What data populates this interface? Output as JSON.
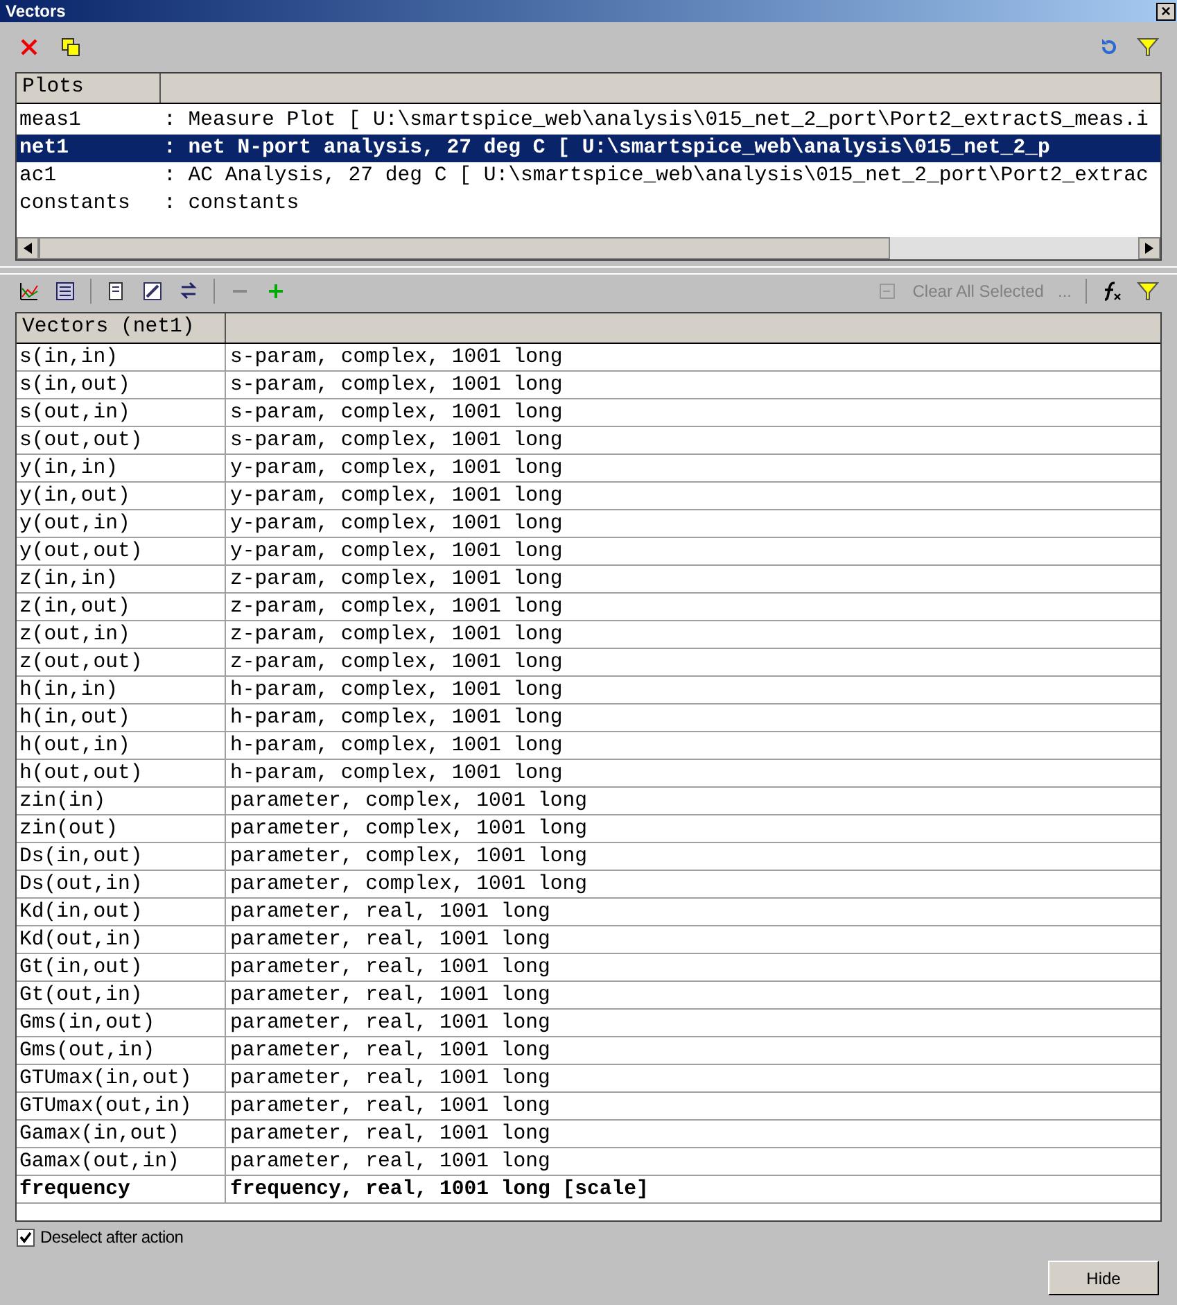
{
  "window": {
    "title": "Vectors",
    "close": "×"
  },
  "plots": {
    "header": "Plots",
    "rows": [
      {
        "name": "meas1",
        "description": ": Measure Plot [ U:\\smartspice_web\\analysis\\015_net_2_port\\Port2_extractS_meas.i",
        "selected": false
      },
      {
        "name": "net1",
        "description": ": net N-port analysis, 27 deg C [ U:\\smartspice_web\\analysis\\015_net_2_p",
        "selected": true
      },
      {
        "name": "ac1",
        "description": ": AC Analysis, 27 deg C [ U:\\smartspice_web\\analysis\\015_net_2_port\\Port2_extrac",
        "selected": false
      },
      {
        "name": "constants",
        "description": ": constants",
        "selected": false
      }
    ]
  },
  "vector_toolbar": {
    "clear_all": {
      "label": "Clear All Selected",
      "disabled": true
    },
    "more": "..."
  },
  "vectors": {
    "header": "Vectors (net1)",
    "rows": [
      {
        "name": "s(in,in)",
        "info": "s-param, complex, 1001 long",
        "kind": "normal"
      },
      {
        "name": "s(in,out)",
        "info": "s-param, complex, 1001 long",
        "kind": "normal"
      },
      {
        "name": "s(out,in)",
        "info": "s-param, complex, 1001 long",
        "kind": "normal"
      },
      {
        "name": "s(out,out)",
        "info": "s-param, complex, 1001 long",
        "kind": "normal"
      },
      {
        "name": "y(in,in)",
        "info": "y-param, complex, 1001 long",
        "kind": "normal"
      },
      {
        "name": "y(in,out)",
        "info": "y-param, complex, 1001 long",
        "kind": "normal"
      },
      {
        "name": "y(out,in)",
        "info": "y-param, complex, 1001 long",
        "kind": "normal"
      },
      {
        "name": "y(out,out)",
        "info": "y-param, complex, 1001 long",
        "kind": "normal"
      },
      {
        "name": "z(in,in)",
        "info": "z-param, complex, 1001 long",
        "kind": "normal"
      },
      {
        "name": "z(in,out)",
        "info": "z-param, complex, 1001 long",
        "kind": "normal"
      },
      {
        "name": "z(out,in)",
        "info": "z-param, complex, 1001 long",
        "kind": "normal"
      },
      {
        "name": "z(out,out)",
        "info": "z-param, complex, 1001 long",
        "kind": "normal"
      },
      {
        "name": "h(in,in)",
        "info": "h-param, complex, 1001 long",
        "kind": "normal"
      },
      {
        "name": "h(in,out)",
        "info": "h-param, complex, 1001 long",
        "kind": "normal"
      },
      {
        "name": "h(out,in)",
        "info": "h-param, complex, 1001 long",
        "kind": "normal"
      },
      {
        "name": "h(out,out)",
        "info": "h-param, complex, 1001 long",
        "kind": "normal"
      },
      {
        "name": "zin(in)",
        "info": "parameter, complex, 1001 long",
        "kind": "normal"
      },
      {
        "name": "zin(out)",
        "info": "parameter, complex, 1001 long",
        "kind": "normal"
      },
      {
        "name": "Ds(in,out)",
        "info": "parameter, complex, 1001 long",
        "kind": "normal"
      },
      {
        "name": "Ds(out,in)",
        "info": "parameter, complex, 1001 long",
        "kind": "normal"
      },
      {
        "name": "Kd(in,out)",
        "info": "parameter, real, 1001 long",
        "kind": "normal"
      },
      {
        "name": "Kd(out,in)",
        "info": "parameter, real, 1001 long",
        "kind": "normal"
      },
      {
        "name": "Gt(in,out)",
        "info": "parameter, real, 1001 long",
        "kind": "normal"
      },
      {
        "name": "Gt(out,in)",
        "info": "parameter, real, 1001 long",
        "kind": "normal"
      },
      {
        "name": "Gms(in,out)",
        "info": "parameter, real, 1001 long",
        "kind": "normal"
      },
      {
        "name": "Gms(out,in)",
        "info": "parameter, real, 1001 long",
        "kind": "normal"
      },
      {
        "name": "GTUmax(in,out)",
        "info": "parameter, real, 1001 long",
        "kind": "normal"
      },
      {
        "name": "GTUmax(out,in)",
        "info": "parameter, real, 1001 long",
        "kind": "normal"
      },
      {
        "name": "Gamax(in,out)",
        "info": "parameter, real, 1001 long",
        "kind": "normal"
      },
      {
        "name": "Gamax(out,in)",
        "info": "parameter, real, 1001 long",
        "kind": "normal"
      },
      {
        "name": "frequency",
        "info": "frequency, real, 1001 long [scale]",
        "kind": "scale"
      }
    ]
  },
  "deselect": {
    "label": "Deselect after action",
    "checked": true
  },
  "hide_button": "Hide"
}
